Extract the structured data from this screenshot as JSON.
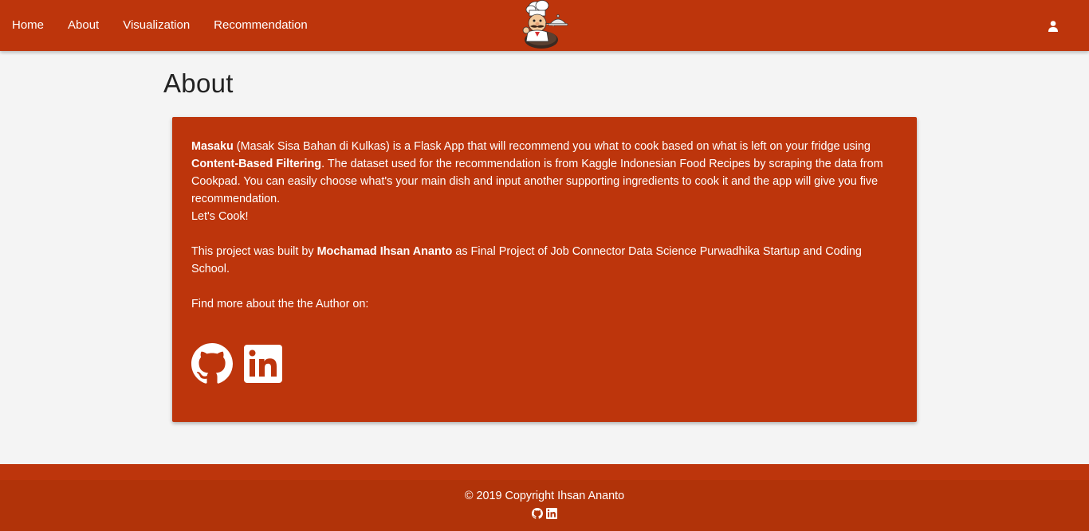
{
  "nav": {
    "links": [
      "Home",
      "About",
      "Visualization",
      "Recommendation"
    ],
    "logo_icon": "chef-mascot-icon",
    "user_icon": "user-icon"
  },
  "page": {
    "title": "About"
  },
  "about": {
    "app_name": "Masaku",
    "p1_a": " (Masak Sisa Bahan di Kulkas) is a Flask App that will recommend you what to cook based on what is left on your fridge using ",
    "method": "Content-Based Filtering",
    "p1_b": ". The dataset used for the recommendation is from Kaggle Indonesian Food Recipes by scraping the data from Cookpad. You can easily choose what's your main dish and input another supporting ingredients to cook it and the app will give you five recommendation.",
    "lets_cook": "Let's Cook!",
    "p2_a": "This project was built by ",
    "author": "Mochamad Ihsan Ananto",
    "p2_b": " as Final Project of Job Connector Data Science Purwadhika Startup and Coding School.",
    "find_more": "Find more about the the Author on:",
    "social_icons": [
      "github-icon",
      "linkedin-icon"
    ]
  },
  "footer": {
    "copyright": "© 2019 Copyright Ihsan Ananto"
  },
  "colors": {
    "brand": "#bd350c",
    "background": "#f4f4f4",
    "text_on_brand": "#ffffff"
  }
}
